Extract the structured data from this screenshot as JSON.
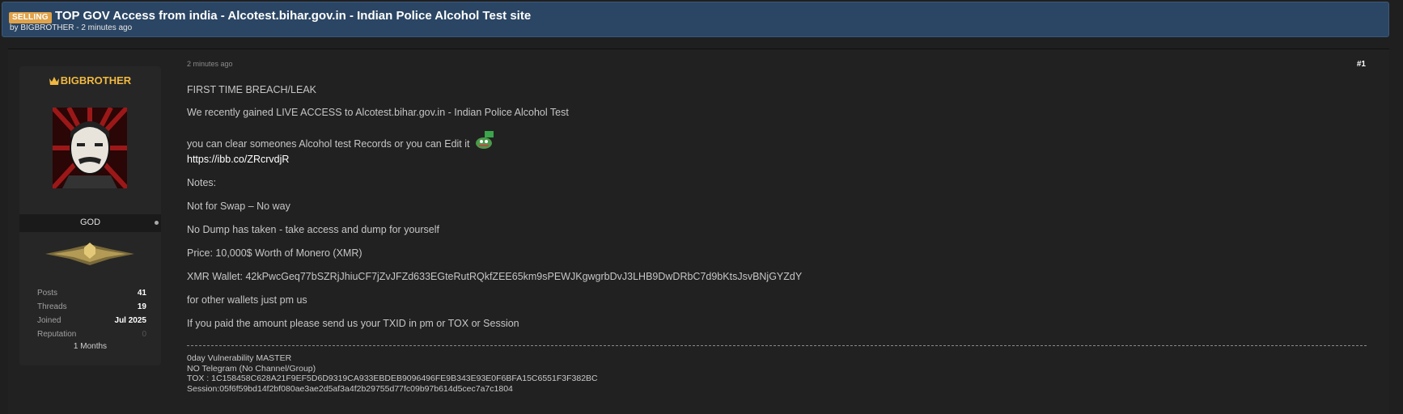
{
  "thread": {
    "prefix": "SELLING",
    "title": "TOP GOV Access from india - Alcotest.bihar.gov.in - Indian Police Alcohol Test site",
    "meta": "by BIGBROTHER - 2 minutes ago"
  },
  "user": {
    "name": "BIGBROTHER",
    "rank": "GOD",
    "stats": [
      {
        "label": "Posts",
        "value": "41"
      },
      {
        "label": "Threads",
        "value": "19"
      },
      {
        "label": "Joined",
        "value": "Jul 2025"
      },
      {
        "label": "Reputation",
        "value": "0"
      }
    ],
    "membership": "1 Months",
    "icons": [
      "crown-icon",
      "avatar-image",
      "rank-badge-icon",
      "online-status-dot"
    ]
  },
  "post": {
    "time": "2 minutes ago",
    "number": "#1",
    "lines": [
      "FIRST TIME BREACH/LEAK",
      "We recently gained LIVE ACCESS to Alcotest.bihar.gov.in - Indian Police Alcohol Test",
      "you can clear someones Alcohol test Records or you can Edit it",
      "https://ibb.co/ZRcrvdjR",
      "Notes:",
      "Not for Swap – No way",
      "No Dump has taken  - take access and dump for yourself",
      "Price: 10,000$ Worth of Monero (XMR)",
      "XMR Wallet: 42kPwcGeq77bSZRjJhiuCF7jZvJFZd633EGteRutRQkfZEE65km9sPEWJKgwgrbDvJ3LHB9DwDRbC7d9bKtsJsvBNjGYZdY",
      "for other wallets just pm us",
      "If you paid the amount please send us your TXID in pm or TOX or Session"
    ]
  },
  "signature": {
    "lines": [
      "0day Vulnerability MASTER",
      "NO Telegram (No Channel/Group)",
      "TOX : 1C158458C628A21F9EF5D6D9319CA933EBDEB9096496FE9B343E93E0F6BFA15C6551F3F382BC",
      "Session:05f6f59bd14f2bf080ae3ae2d5af3a4f2b29755d77fc09b97b614d5cec7a7c1804"
    ]
  },
  "colors": {
    "header_bg": "#2b4664",
    "prefix_bg": "#e0a34a",
    "username": "#f0b840",
    "page_bg": "#1f1f1f"
  }
}
